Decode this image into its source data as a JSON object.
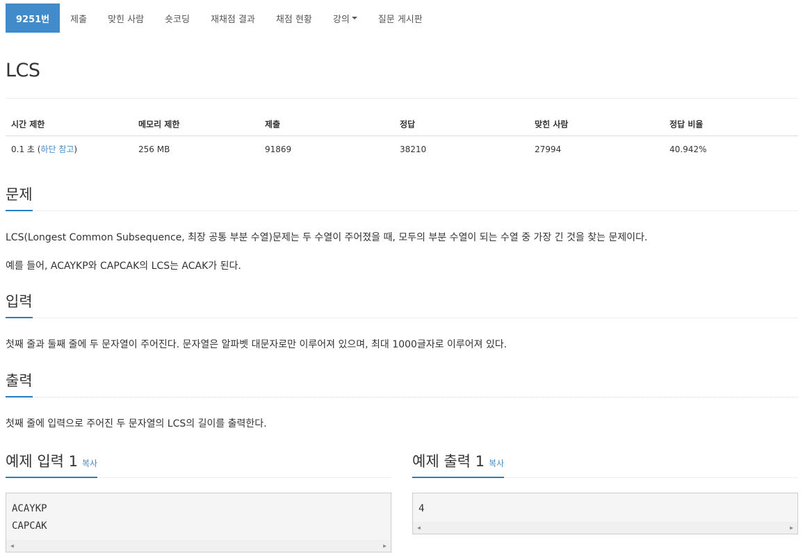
{
  "nav": {
    "items": [
      {
        "label": "9251번",
        "active": true
      },
      {
        "label": "제출"
      },
      {
        "label": "맞힌 사람"
      },
      {
        "label": "숏코딩"
      },
      {
        "label": "재채점 결과"
      },
      {
        "label": "채점 현황"
      },
      {
        "label": "강의",
        "dropdown": true
      },
      {
        "label": "질문 게시판"
      }
    ]
  },
  "problem": {
    "title": "LCS"
  },
  "stats": {
    "headers": [
      "시간 제한",
      "메모리 제한",
      "제출",
      "정답",
      "맞힌 사람",
      "정답 비율"
    ],
    "time_prefix": "0.1 초 (",
    "time_link": "하단 참고",
    "time_suffix": ")",
    "memory": "256 MB",
    "submissions": "91869",
    "accepted": "38210",
    "solvers": "27994",
    "ratio": "40.942%"
  },
  "sections": {
    "problem_heading": "문제",
    "problem_text_1": "LCS(Longest Common Subsequence, 최장 공통 부분 수열)문제는 두 수열이 주어졌을 때, 모두의 부분 수열이 되는 수열 중 가장 긴 것을 찾는 문제이다.",
    "problem_text_2": "예를 들어, ACAYKP와 CAPCAK의 LCS는 ACAK가 된다.",
    "input_heading": "입력",
    "input_text": "첫째 줄과 둘째 줄에 두 문자열이 주어진다. 문자열은 알파벳 대문자로만 이루어져 있으며, 최대 1000글자로 이루어져 있다.",
    "output_heading": "출력",
    "output_text": "첫째 줄에 입력으로 주어진 두 문자열의 LCS의 길이를 출력한다."
  },
  "samples": {
    "input_heading": "예제 입력 1",
    "output_heading": "예제 출력 1",
    "copy_label": "복사",
    "input_lines": [
      "ACAYKP",
      "CAPCAK"
    ],
    "output_lines": [
      "4"
    ]
  },
  "colors": {
    "accent": "#428bca",
    "heading_underline": "#2a7bbd"
  }
}
